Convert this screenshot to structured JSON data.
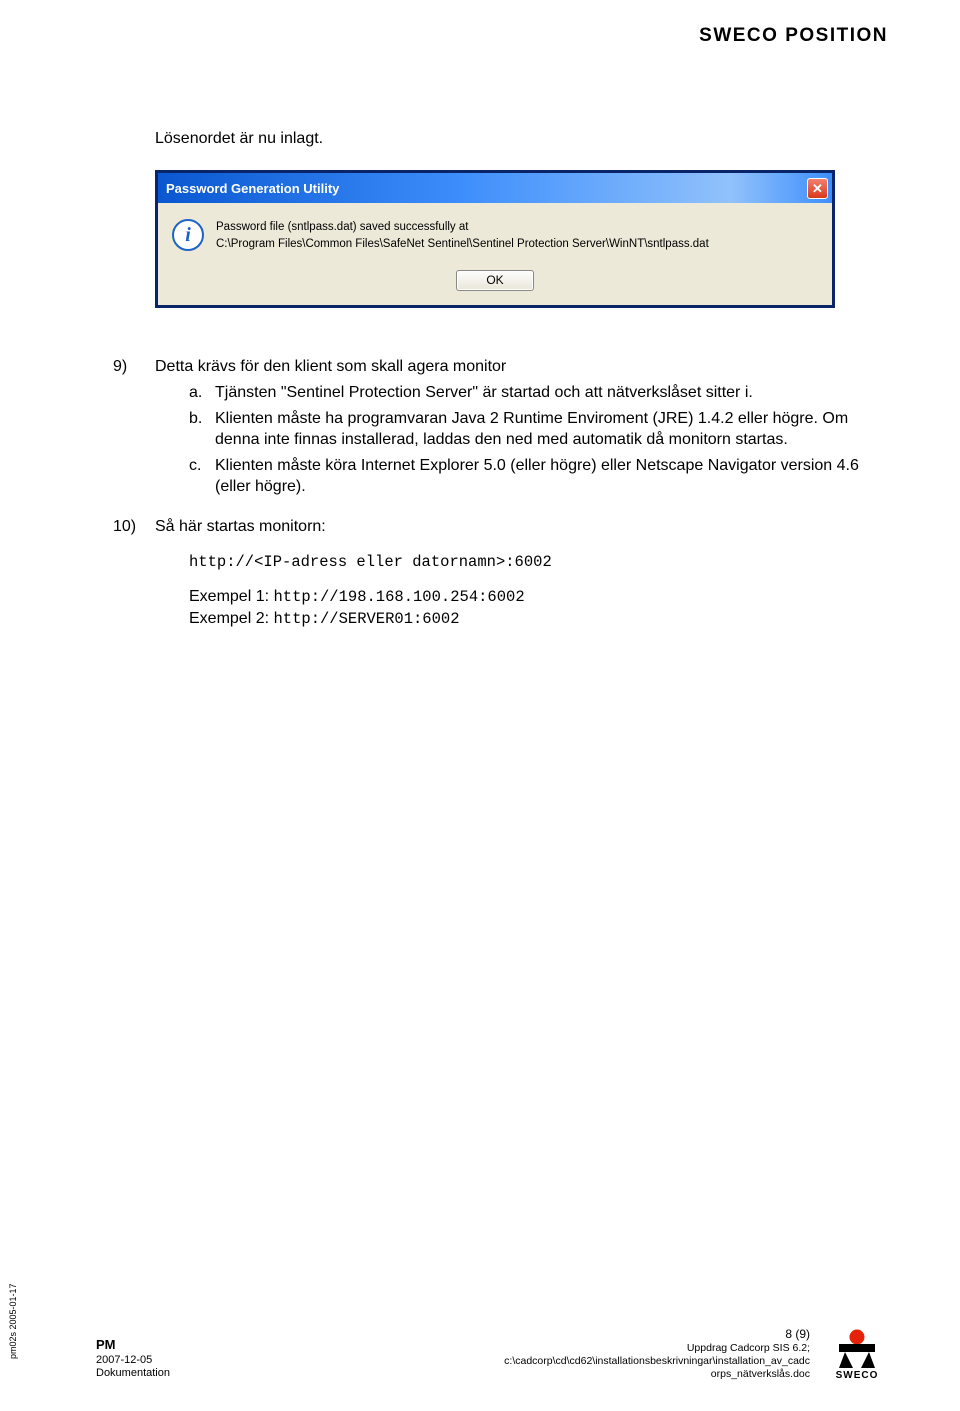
{
  "brand_header": "SWECO POSITION",
  "para_intro": "Lösenordet är nu inlagt.",
  "dialog": {
    "title": "Password Generation Utility",
    "close_glyph": "✕",
    "line1": "Password file (sntlpass.dat) saved successfully at",
    "line2": "C:\\Program Files\\Common Files\\SafeNet Sentinel\\Sentinel Protection Server\\WinNT\\sntlpass.dat",
    "ok_label": "OK"
  },
  "list": {
    "item9": {
      "num": "9)",
      "text": "Detta krävs för den klient som skall agera monitor",
      "a": {
        "mark": "a.",
        "text": "Tjänsten \"Sentinel Protection Server\" är startad och att nätverkslåset sitter i."
      },
      "b": {
        "mark": "b.",
        "text": "Klienten måste ha programvaran Java 2 Runtime Enviroment (JRE) 1.4.2 eller högre. Om denna inte finnas installerad, laddas den ned med automatik då monitorn startas."
      },
      "c": {
        "mark": "c.",
        "text": "Klienten måste köra Internet Explorer 5.0 (eller högre) eller Netscape Navigator version 4.6 (eller högre)."
      }
    },
    "item10": {
      "num": "10)",
      "text": "Så här startas monitorn:",
      "http": "http://<IP-adress eller datornamn>:6002",
      "ex1_label": "Exempel 1: ",
      "ex1_value": "http://198.168.100.254:6002",
      "ex2_label": "Exempel 2: ",
      "ex2_value": "http://SERVER01:6002"
    }
  },
  "side_code": "pm02s 2005-01-17",
  "footer": {
    "pm": "PM",
    "date": "2007-12-05",
    "dok": "Dokumentation",
    "page": "8 (9)",
    "uppdrag": "Uppdrag Cadcorp SIS 6.2;",
    "path1": "c:\\cadcorp\\cd\\cd62\\installationsbeskrivningar\\installation_av_cadc",
    "path2": "orps_nätverkslås.doc",
    "logo_text": "SWECO"
  }
}
